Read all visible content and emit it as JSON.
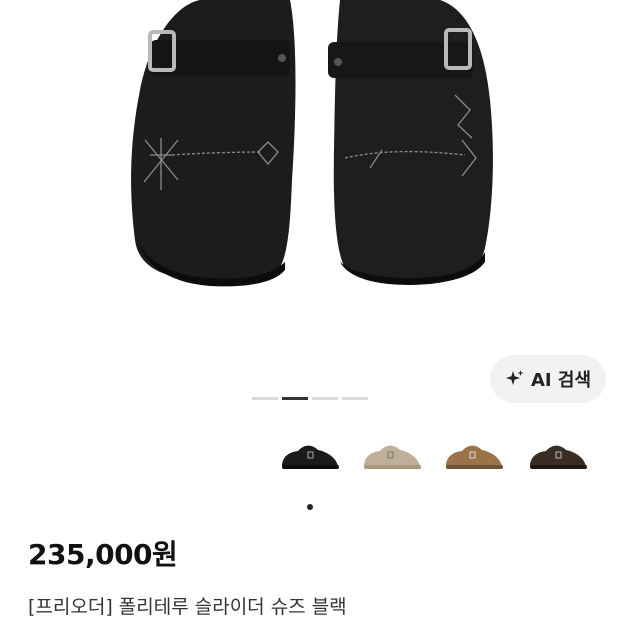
{
  "ai_search": {
    "label": "AI 검색",
    "icon": "sparkle-icon"
  },
  "carousel": {
    "total": 4,
    "active_index": 1
  },
  "color_options": [
    {
      "name": "black",
      "color": "#1a1a1a"
    },
    {
      "name": "beige",
      "color": "#bfae98"
    },
    {
      "name": "brown",
      "color": "#9a7448"
    },
    {
      "name": "dark-brown",
      "color": "#3a2e24"
    }
  ],
  "product": {
    "price": "235,000원",
    "title": "[프리오더] 폴리테루 슬라이더 슈즈 블랙"
  }
}
